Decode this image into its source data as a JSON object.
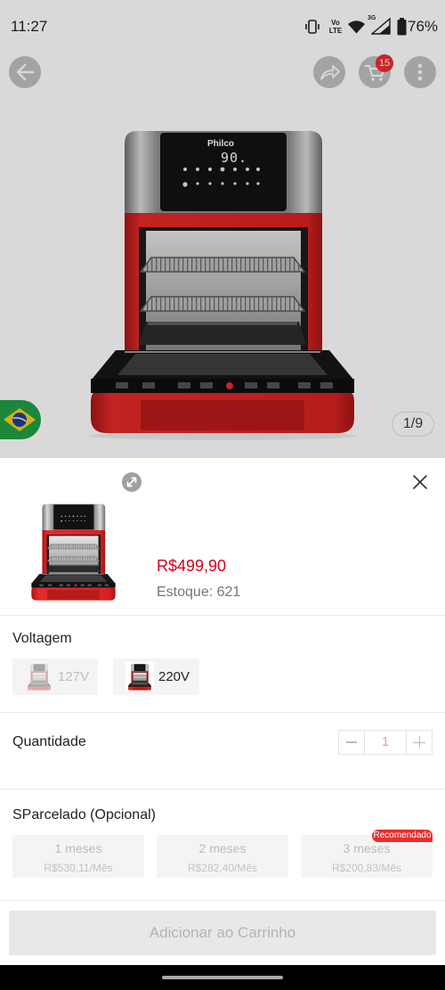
{
  "status_bar": {
    "time": "11:27",
    "volte_top": "Vo",
    "volte_bottom": "LTE",
    "network_type": "3G",
    "battery": "76%",
    "icons": [
      "vibrate-icon",
      "volte-icon",
      "wifi-icon",
      "signal-icon",
      "battery-icon"
    ]
  },
  "header": {
    "cart_badge": "15",
    "icons": {
      "back": "arrow-left-icon",
      "share": "share-icon",
      "cart": "cart-icon",
      "more": "more-vertical-icon"
    }
  },
  "gallery": {
    "product_brand": "Philco",
    "display_reading": "90.",
    "page_indicator": "1/9",
    "origin_flag": "brazil-flag-icon"
  },
  "sheet": {
    "price": "R$499,90",
    "stock": "Estoque: 621",
    "voltage": {
      "title": "Voltagem",
      "options": [
        {
          "label": "127V",
          "available": false
        },
        {
          "label": "220V",
          "available": true
        }
      ]
    },
    "quantity": {
      "title": "Quantidade",
      "value": "1"
    },
    "installments": {
      "title": "SParcelado (Opcional)",
      "options": [
        {
          "months": "1 meses",
          "amount": "R$530,11/Mês"
        },
        {
          "months": "2 meses",
          "amount": "R$282,40/Mês"
        },
        {
          "months": "3 meses",
          "amount": "R$200,83/Mês",
          "badge": "Recomendado"
        }
      ]
    },
    "add_to_cart_label": "Adicionar ao Carrinho",
    "icons": {
      "expand": "expand-icon",
      "close": "close-icon",
      "decrease": "minus-icon",
      "increase": "plus-icon"
    }
  },
  "colors": {
    "price": "#d0011b",
    "badge": "#ee2c2c",
    "button_disabled": "#e8e8e8"
  }
}
